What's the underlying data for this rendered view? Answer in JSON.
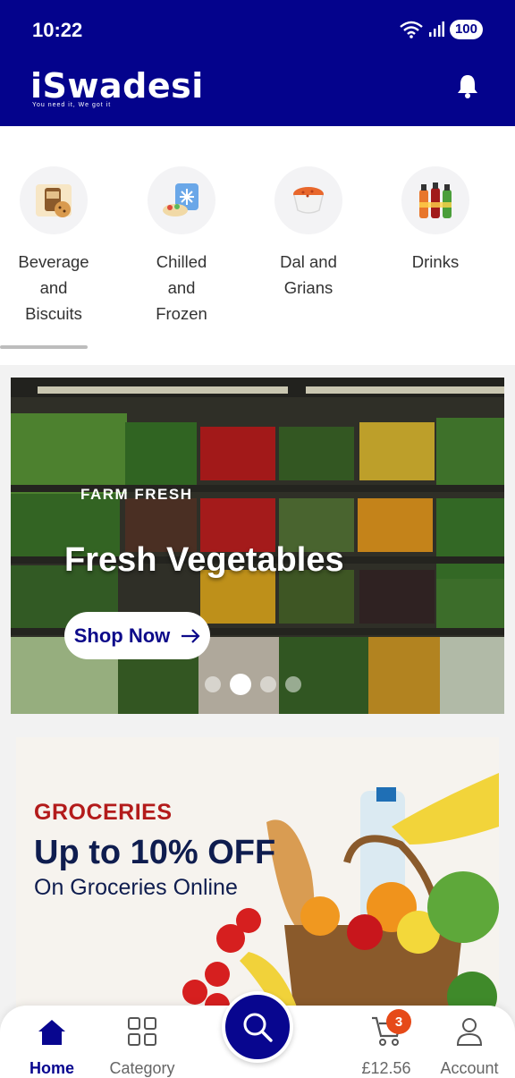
{
  "status": {
    "time": "10:22",
    "battery": "100"
  },
  "header": {
    "logo": "iSwadesi",
    "tagline": "You need it, We got it",
    "bell": "bell-icon"
  },
  "categories": [
    {
      "label": "Beverage and Biscuits",
      "icon": "beverage-icon"
    },
    {
      "label": "Chilled and Frozen",
      "icon": "frozen-icon"
    },
    {
      "label": "Dal and Grians",
      "icon": "dal-icon"
    },
    {
      "label": "Drinks",
      "icon": "drinks-icon"
    }
  ],
  "banner1": {
    "subtitle": "FARM FRESH",
    "title": "Fresh Vegetables",
    "button": "Shop Now",
    "slides": 4,
    "active_slide": 2
  },
  "banner2": {
    "label": "GROCERIES",
    "offer": "Up to 10% OFF",
    "sub": "On Groceries Online"
  },
  "nav": {
    "home": "Home",
    "category": "Category",
    "cart_total": "£12.56",
    "cart_count": "3",
    "account": "Account"
  },
  "colors": {
    "brand": "#04038c",
    "accent": "#e64a19",
    "groceries_red": "#b31b1b"
  }
}
